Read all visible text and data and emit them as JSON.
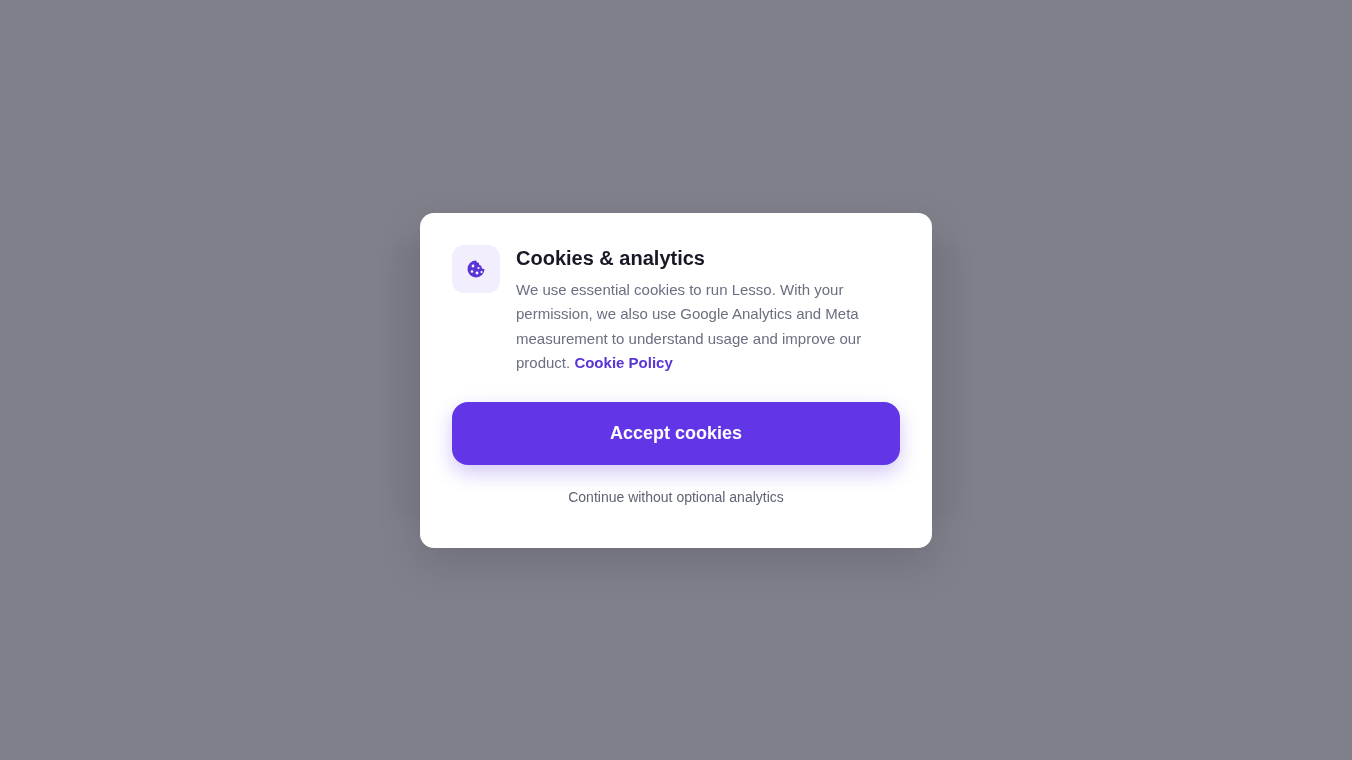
{
  "dialog": {
    "title": "Cookies & analytics",
    "body": "We use essential cookies to run Lesso. With your permission, we also use Google Analytics and Meta measurement to understand usage and improve our product.",
    "policy_link": "Cookie Policy",
    "accept_button": "Accept cookies",
    "decline_link": "Continue without optional analytics"
  }
}
